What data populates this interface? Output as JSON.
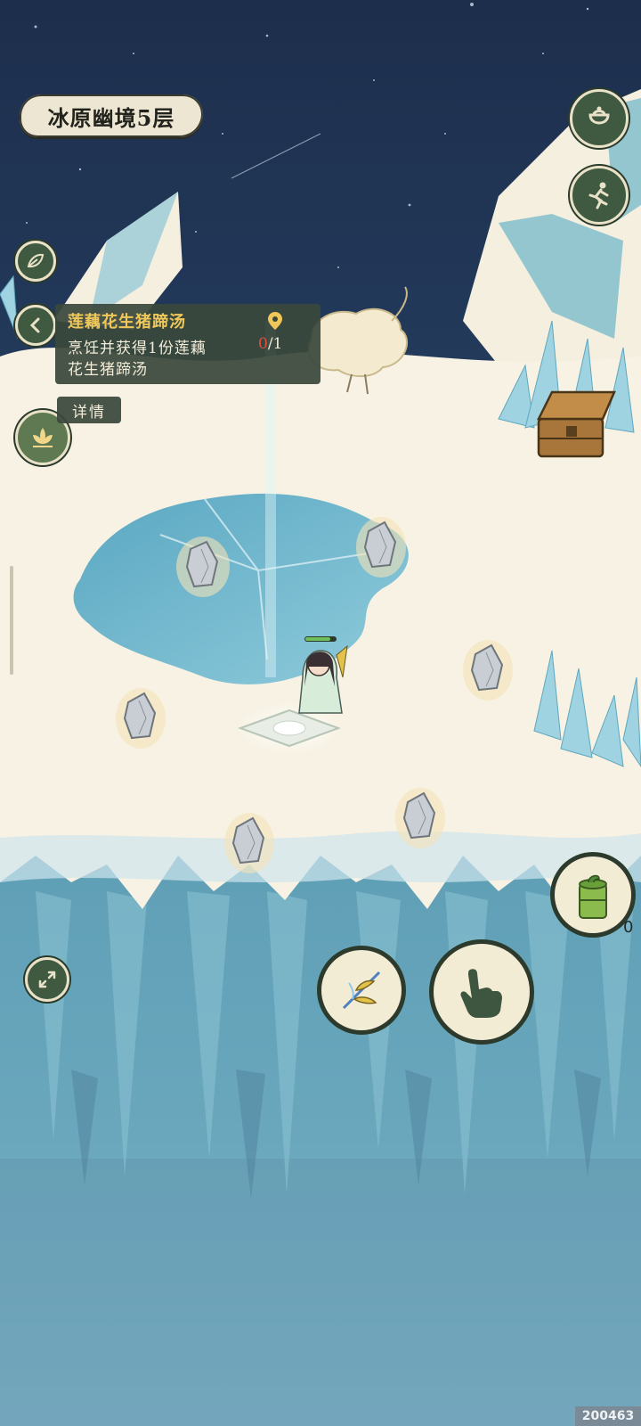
{
  "location": {
    "title": "冰原幽境5层"
  },
  "quest": {
    "title": "莲藕花生猪蹄汤",
    "description_line1": "烹饪并获得1份莲藕",
    "description_line2": "花生猪蹄汤",
    "progress_current": "0",
    "progress_total": "/1",
    "detail_label": "详情"
  },
  "inventory": {
    "bamboo_item_count": "0"
  },
  "watermark": {
    "id": "200463"
  },
  "icons": {
    "bag": "pot-icon",
    "run": "running-figure-icon",
    "leaf": "leaf-icon",
    "back": "chevron-left-icon",
    "lotus": "lotus-icon",
    "expand": "expand-arrows-icon",
    "attack": "bamboo-spear-icon",
    "interact": "pointing-hand-icon",
    "location": "map-pin-icon",
    "item": "bamboo-tube-icon"
  },
  "colors": {
    "sky": "#1e3150",
    "snow": "#f7f2e3",
    "ice": "#7fbfd2",
    "button_green": "#3f5a40",
    "quest_title": "#f0c85a",
    "progress_red": "#e0503c"
  }
}
